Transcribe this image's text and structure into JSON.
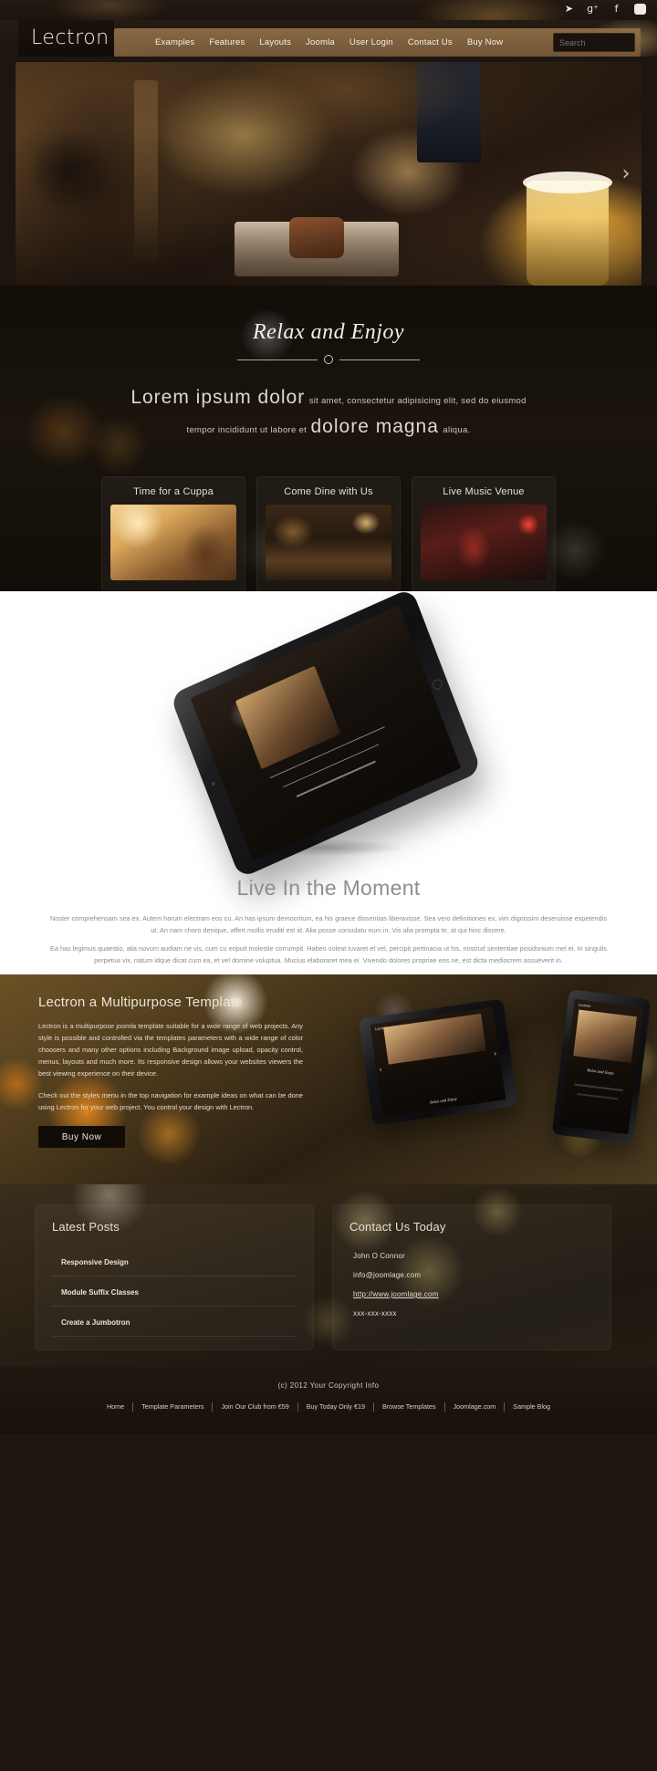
{
  "topbar": {
    "social": [
      {
        "name": "twitter-icon",
        "glyph": "🐦"
      },
      {
        "name": "google-plus-icon",
        "glyph": "g⁺"
      },
      {
        "name": "facebook-icon",
        "glyph": "f"
      },
      {
        "name": "skype-icon",
        "glyph": "S"
      }
    ]
  },
  "nav": {
    "logo": "Lectron",
    "items": [
      {
        "label": "Examples"
      },
      {
        "label": "Features"
      },
      {
        "label": "Layouts"
      },
      {
        "label": "Joomla"
      },
      {
        "label": "User Login"
      },
      {
        "label": "Contact Us"
      },
      {
        "label": "Buy Now"
      }
    ],
    "search_placeholder": "Search",
    "search_value": ""
  },
  "hero": {
    "next_arrow": "›"
  },
  "relax": {
    "title": "Relax and Enjoy",
    "lead_big_1": "Lorem ipsum dolor",
    "lead_small_1": "sit amet, consectetur adipisicing elit, sed do eiusmod",
    "lead_small_2": "tempor incididunt ut labore et",
    "lead_big_2": "dolore magna",
    "lead_small_3": "aliqua.",
    "boxes": [
      {
        "title": "Time for a Cuppa"
      },
      {
        "title": "Come Dine with Us"
      },
      {
        "title": "Live Music Venue"
      }
    ]
  },
  "moment": {
    "title": "Live In the Moment",
    "paragraph1": "Noster comprehensam sea ex. Autem harum electram eos cu. An has ipsum democritum, ea his graece dissentias liberavisse. Sea vero definitiones ex, vim dignissim deseruisse expetendis ut. An nam choro denique, affert mollis eruditi est id. Alia posse consulatu eum in. Vis alia prompta te, at qui hinc discere.",
    "paragraph2": "Ea has legimus quaestio, alia novum audiam ne vis, cum cu eripuit molestie corrumpit. Habeo soleat iuvaret et vel, percipit pertinacia ut his, nostrud sententiae posidonium mel ei. In singulis perpetua vix, natum idque dicat cum ea, et vel domine voluptua. Mucius elaboraret mea ei. Vivendo dolores propriae eos ne, est dicta mediocrem assueverit in."
  },
  "multipurpose": {
    "title": "Lectron a Multipurpose Template",
    "paragraph1": "Lectron is a multipurpose joomla template suitable for a wide range of web projects.  Any style is possible and controlled via the templates parameters with a wide range of color choosers and many other options including Background image upload, opacity control, menus, layouts and much more.  Its responsive design allows your websites viewers the best viewing experience on their device.",
    "paragraph2": "Check out the styles menu in the top navigation for example ideas on what can be done using Lectron for your web project.  You control your design with Lectron.",
    "buy_button": "Buy Now",
    "device_caption": "Relax and Enjoy",
    "device_logo": "Lectron",
    "device_prev": "‹",
    "device_next": "›"
  },
  "panels": {
    "latest_posts": {
      "title": "Latest Posts",
      "items": [
        {
          "label": "Responsive Design"
        },
        {
          "label": "Module Suffix Classes"
        },
        {
          "label": "Create a Jumbotron"
        }
      ]
    },
    "contact": {
      "title": "Contact Us Today",
      "name": "John O  Connor",
      "email": "info@joomlage.com",
      "website": "http://www.joomlage.com",
      "phone": "xxx-xxx-xxxx"
    }
  },
  "footer": {
    "copyright": "(c)  2012  Your  Copyright  Info",
    "links": [
      {
        "label": "Home"
      },
      {
        "label": "Template Parameters"
      },
      {
        "label": "Join Our Club from €59"
      },
      {
        "label": "Buy Today Only €19"
      },
      {
        "label": "Browse Templates"
      },
      {
        "label": "Joomlage.com"
      },
      {
        "label": "Sample Blog"
      }
    ]
  }
}
